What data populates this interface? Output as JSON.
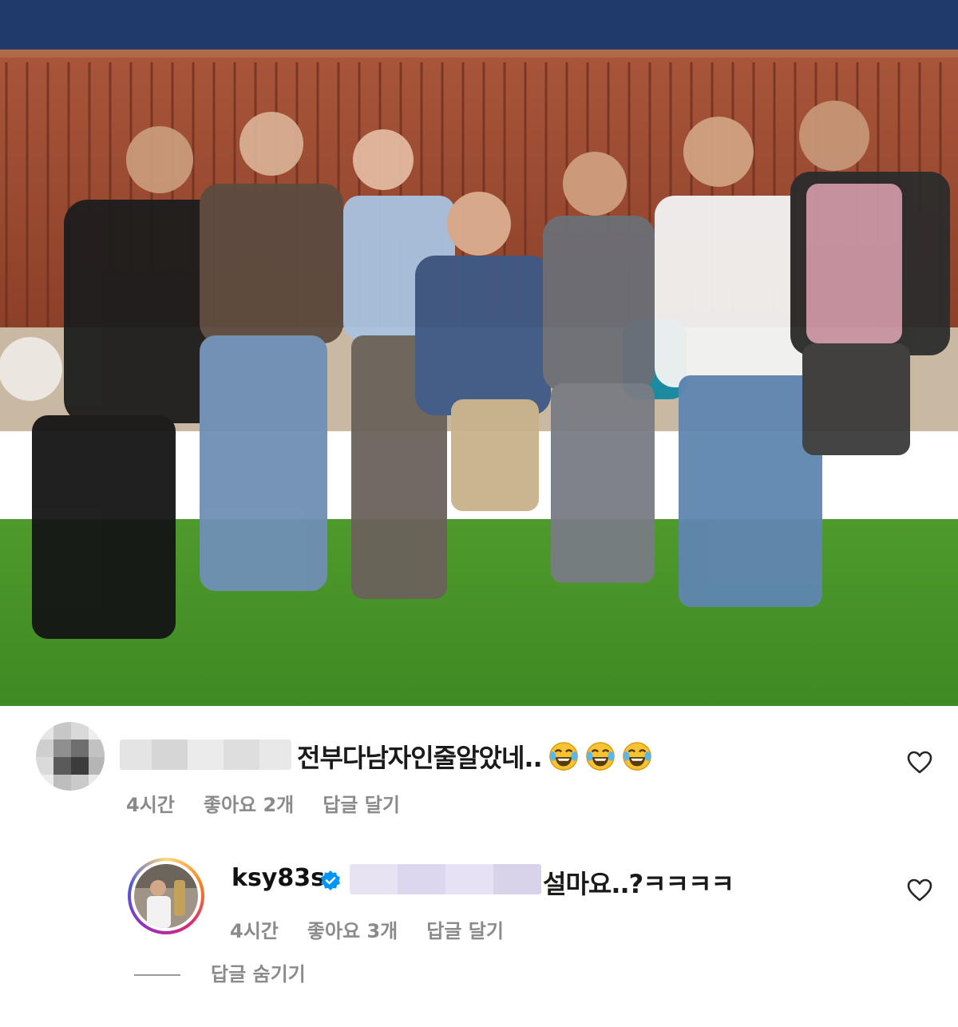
{
  "photo": {
    "description_icon": "group-photo"
  },
  "comments": [
    {
      "text": "전부다남자인줄알았네..",
      "emoji_icon": "laughing-crying-emoji",
      "emoji_count": 3,
      "time": "4시간",
      "likes": "좋아요 2개",
      "reply": "답글 달기"
    }
  ],
  "reply": {
    "username": "ksy83s",
    "verified_icon": "verified-badge-icon",
    "text": "설마요..?ㅋㅋㅋㅋ",
    "time": "4시간",
    "likes": "좋아요 3개",
    "reply": "답글 달기",
    "hide_replies": "답글 숨기기"
  },
  "colors": {
    "meta_gray": "#8a8a8a",
    "verified_blue": "#0095f6"
  }
}
